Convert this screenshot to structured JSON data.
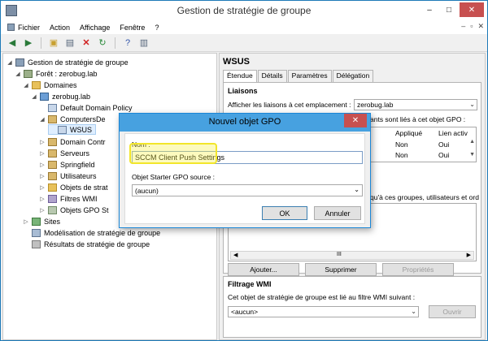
{
  "window": {
    "title": "Gestion de stratégie de groupe",
    "controls": [
      "–",
      "□",
      "✕"
    ]
  },
  "menu": {
    "items": [
      "Fichier",
      "Action",
      "Affichage",
      "Fenêtre",
      "?"
    ],
    "mdi_controls": [
      "–",
      "▫",
      "✕"
    ]
  },
  "tree": {
    "root": "Gestion de stratégie de groupe",
    "forest": "Forêt : zerobug.lab",
    "domains": "Domaines",
    "domain": "zerobug.lab",
    "default_policy": "Default Domain Policy",
    "computers_ou": "ComputersDe",
    "wsus": "WSUS",
    "domain_controllers": "Domain Contr",
    "servers": "Serveurs",
    "springfield": "Springfield",
    "users": "Utilisateurs",
    "gpo_objects": "Objets de strat",
    "wmi_filters": "Filtres WMI",
    "starter_gpo": "Objets GPO St",
    "sites": "Sites",
    "modeling": "Modélisation de stratégie de groupe",
    "results": "Résultats de stratégie de groupe"
  },
  "right": {
    "title": "WSUS",
    "tabs": [
      "Étendue",
      "Détails",
      "Paramètres",
      "Délégation"
    ],
    "links_title": "Liaisons",
    "links_label": "Afficher les liaisons à cet emplacement :",
    "links_value": "zerobug.lab",
    "links_desc_tail": "ants sont liés à cet objet GPO :",
    "grid_headers": [
      "Appliqué",
      "Lien activ"
    ],
    "grid_rows": [
      [
        "Non",
        "Oui"
      ],
      [
        "Non",
        "Oui"
      ]
    ],
    "security_desc_tail": "qu'à ces groupes, utilisateurs et ord",
    "scroll_thumb": "III",
    "btn_add": "Ajouter...",
    "btn_remove": "Supprimer",
    "btn_props": "Propriétés",
    "wmi_title": "Filtrage WMI",
    "wmi_label": "Cet objet de stratégie de groupe est lié au filtre WMI suivant :",
    "wmi_value": "<aucun>",
    "wmi_open": "Ouvrir"
  },
  "dialog": {
    "title": "Nouvel objet GPO",
    "close": "✕",
    "name_label": "Nom :",
    "name_value": "SCCM Client Push Settings",
    "starter_label": "Objet Starter GPO source :",
    "starter_value": "(aucun)",
    "ok": "OK",
    "cancel": "Annuler"
  }
}
